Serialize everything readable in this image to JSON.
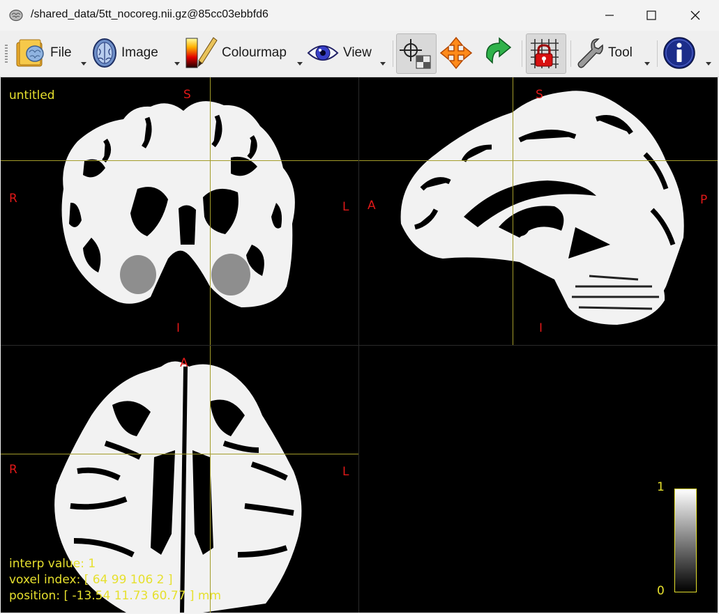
{
  "window": {
    "title": "/shared_data/5tt_nocoreg.nii.gz@85cc03ebbfd6",
    "app_icon": "brain-icon",
    "controls": [
      "minimize-icon",
      "maximize-icon",
      "close-icon"
    ]
  },
  "toolbar": {
    "file": "File",
    "image": "Image",
    "colourmap": "Colourmap",
    "view": "View",
    "tool": "Tool",
    "icons": [
      "folder-brain-icon",
      "brain-image-icon",
      "colourmap-pencil-icon",
      "eye-icon",
      "crosshair-window-icon",
      "move-arrows-icon",
      "rotate-arrow-icon",
      "lock-grid-icon",
      "wrench-icon",
      "info-icon"
    ]
  },
  "viewer": {
    "image_name": "untitled",
    "coronal": {
      "top": "S",
      "bottom": "I",
      "left": "R",
      "right": "L"
    },
    "sagittal": {
      "top": "S",
      "bottom": "I",
      "left": "A",
      "right": "P"
    },
    "axial": {
      "top": "A",
      "left": "R",
      "right": "L"
    },
    "info": {
      "interp": "interp value: 1",
      "voxel": "voxel index: [ 64 99 106 2 ]",
      "position": "position: [ -13.54 11.73 60.77 ] mm"
    },
    "colorbar": {
      "max": "1",
      "min": "0"
    }
  },
  "colors": {
    "crosshair": "#a39c2a",
    "orientation_label": "#e01818",
    "overlay_text": "#e6e02e"
  }
}
